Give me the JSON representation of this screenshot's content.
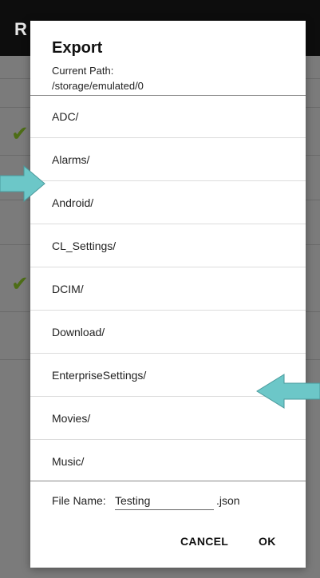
{
  "background": {
    "title_fragment": "R",
    "menu_glyph": "⋮",
    "check_glyph": "✔"
  },
  "dialog": {
    "title": "Export",
    "path_label": "Current Path:",
    "path_value": "/storage/emulated/0",
    "items": [
      {
        "label": "ADC/"
      },
      {
        "label": "Alarms/"
      },
      {
        "label": "Android/"
      },
      {
        "label": "CL_Settings/"
      },
      {
        "label": "DCIM/"
      },
      {
        "label": "Download/"
      },
      {
        "label": "EnterpriseSettings/"
      },
      {
        "label": "Movies/"
      },
      {
        "label": "Music/"
      }
    ],
    "file_name_label": "File Name:",
    "file_name_value": "Testing",
    "extension": ".json",
    "cancel_label": "CANCEL",
    "ok_label": "OK"
  },
  "colors": {
    "annotation_arrow": "#6cc7c8",
    "check": "#4d6d16"
  }
}
